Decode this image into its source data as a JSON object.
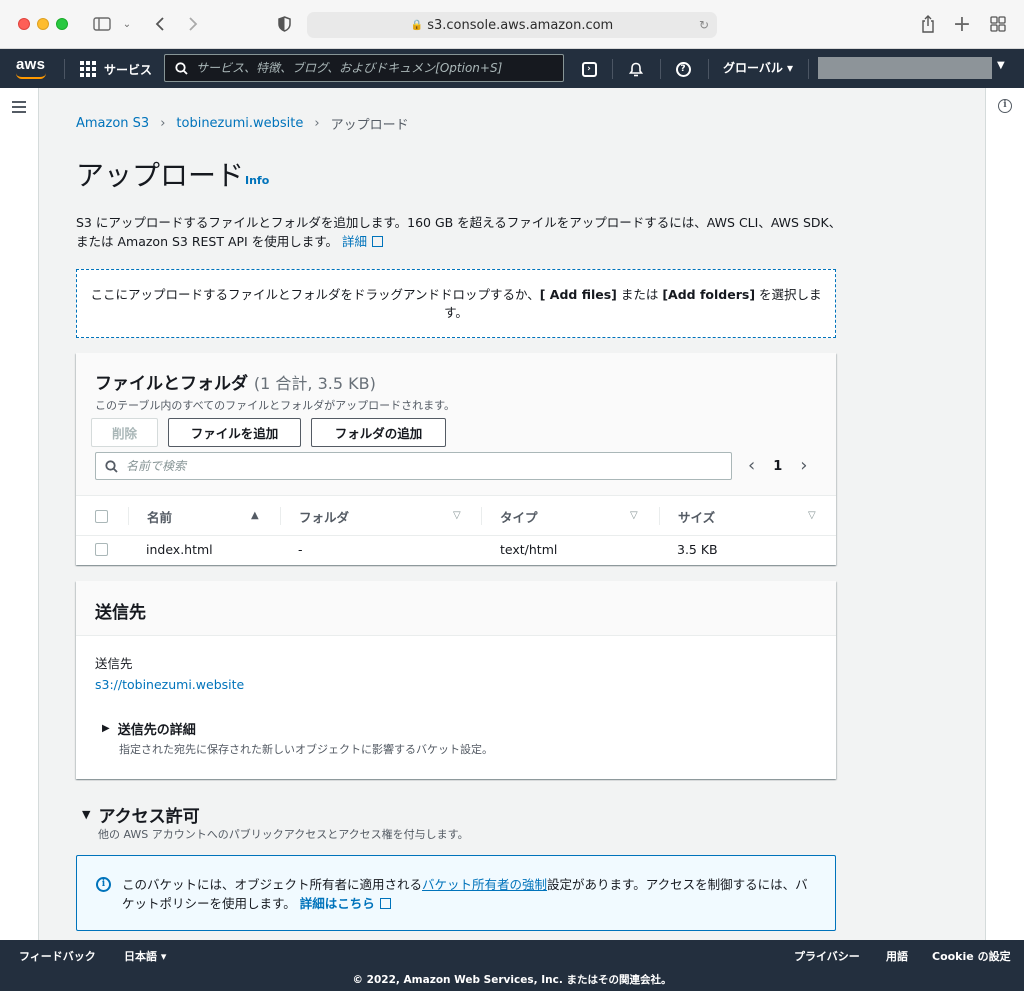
{
  "browser": {
    "url": "s3.console.aws.amazon.com"
  },
  "topnav": {
    "logo": "aws",
    "services_label": "サービス",
    "search_placeholder": "サービス、特徴、ブログ、およびドキュメン[Option+S]",
    "region_label": "グローバル ▾"
  },
  "breadcrumb": {
    "items": [
      "Amazon S3",
      "tobinezumi.website",
      "アップロード"
    ]
  },
  "page": {
    "title": "アップロード",
    "info_label": "Info",
    "description": "S3 にアップロードするファイルとフォルダを追加します。160 GB を超えるファイルをアップロードするには、AWS CLI、AWS SDK、または Amazon S3 REST API を使用します。",
    "description_link": "詳細"
  },
  "dropzone": {
    "text_before": "ここにアップロードするファイルとフォルダをドラッグアンドドロップするか、",
    "add_files": "[ Add files]",
    "text_middle": " または ",
    "add_folders": "[Add folders]",
    "text_after": " を選択します。"
  },
  "files_panel": {
    "title": "ファイルとフォルダ",
    "count": "(1 合計, 3.5 KB)",
    "subtitle": "このテーブル内のすべてのファイルとフォルダがアップロードされます。",
    "delete_button": "削除",
    "add_files_button": "ファイルを追加",
    "add_folder_button": "フォルダの追加",
    "search_placeholder": "名前で検索",
    "page_number": "1",
    "columns": [
      "名前",
      "フォルダ",
      "タイプ",
      "サイズ"
    ],
    "rows": [
      {
        "name": "index.html",
        "folder": "-",
        "type": "text/html",
        "size": "3.5 KB"
      }
    ]
  },
  "destination": {
    "title": "送信先",
    "label": "送信先",
    "value": "s3://tobinezumi.website",
    "details_title": "送信先の詳細",
    "details_sub": "指定された宛先に保存された新しいオブジェクトに影響するバケット設定。"
  },
  "access": {
    "title": "アクセス許可",
    "subtitle": "他の AWS アカウントへのパブリックアクセスとアクセス権を付与します。",
    "alert_before": "このバケットには、オブジェクト所有者に適用される",
    "alert_link": "バケット所有者の強制",
    "alert_after": "設定があります。アクセスを制御するには、バケットポリシーを使用します。",
    "alert_more": "詳細はこちら"
  },
  "footer": {
    "feedback": "フィードバック",
    "language": "日本語 ▾",
    "privacy": "プライバシー",
    "terms": "用語",
    "cookie": "Cookie の設定",
    "copyright": "© 2022, Amazon Web Services, Inc. またはその関連会社。"
  }
}
